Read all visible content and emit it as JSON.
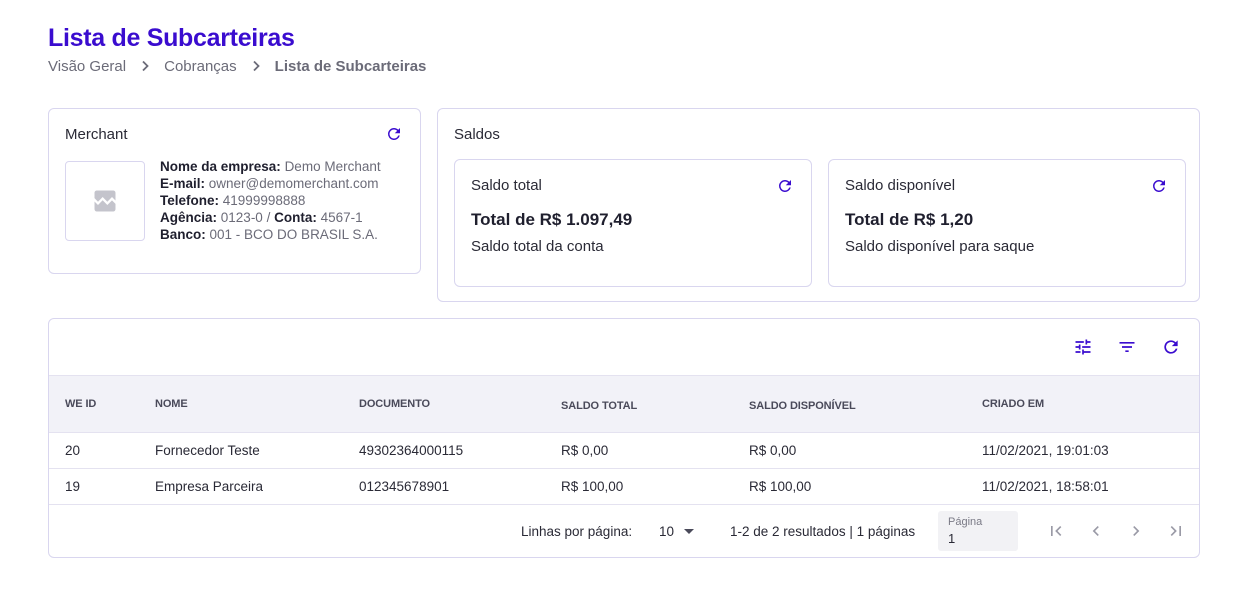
{
  "page": {
    "title": "Lista de Subcarteiras",
    "breadcrumb": [
      "Visão Geral",
      "Cobranças",
      "Lista de Subcarteiras"
    ]
  },
  "merchant": {
    "title": "Merchant",
    "fields": {
      "empresa_label": "Nome da empresa:",
      "empresa_value": "Demo Merchant",
      "email_label": "E-mail:",
      "email_value": "owner@demomerchant.com",
      "telefone_label": "Telefone:",
      "telefone_value": "41999998888",
      "agencia_label": "Agência:",
      "agencia_value": "0123-0",
      "conta_label": "Conta:",
      "conta_value": "4567-1",
      "banco_label": "Banco:",
      "banco_value": "001 - BCO DO BRASIL S.A."
    }
  },
  "saldos": {
    "title": "Saldos",
    "total": {
      "title": "Saldo total",
      "amount": "Total de R$ 1.097,49",
      "desc": "Saldo total da conta"
    },
    "disponivel": {
      "title": "Saldo disponível",
      "amount": "Total de R$ 1,20",
      "desc": "Saldo disponível para saque"
    }
  },
  "table": {
    "columns": [
      "WE ID",
      "NOME",
      "DOCUMENTO",
      "SALDO TOTAL",
      "SALDO DISPONÍVEL",
      "CRIADO EM"
    ],
    "rows": [
      [
        "20",
        "Fornecedor Teste",
        "49302364000115",
        "R$ 0,00",
        "R$ 0,00",
        "11/02/2021, 19:01:03"
      ],
      [
        "19",
        "Empresa Parceira",
        "012345678901",
        "R$ 100,00",
        "R$ 100,00",
        "11/02/2021, 18:58:01"
      ]
    ]
  },
  "pagination": {
    "rows_label": "Linhas por página:",
    "rows_value": "10",
    "results": "1-2 de 2 resultados | 1 páginas",
    "page_label": "Página",
    "page_value": "1"
  },
  "colors": {
    "accent": "#3a0ccf",
    "border": "#d9d6ef",
    "header_bg": "#f2f2f8"
  }
}
